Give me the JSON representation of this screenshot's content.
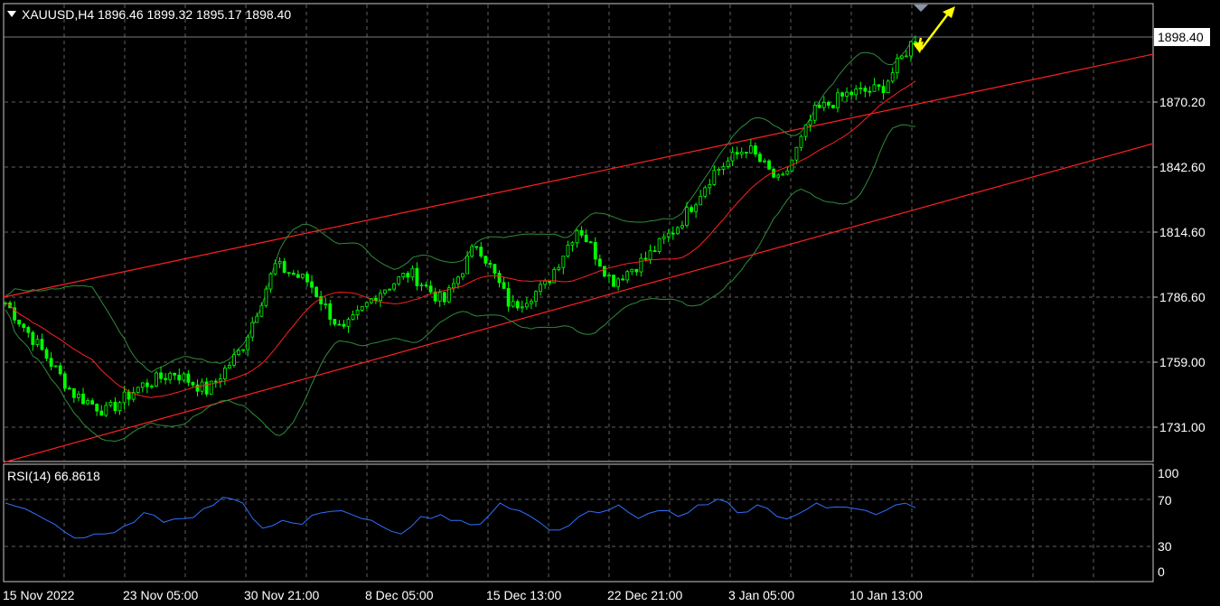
{
  "window": {
    "symbol_header": "XAUUSD,H4  1896.46 1899.32 1895.17 1898.40"
  },
  "colors": {
    "background": "#000000",
    "grid": "#5f5f5f",
    "frame": "#c8c8c8",
    "candle_up": "#00ff00",
    "candle_down": "#00ff00",
    "bollinger": "#2e8b3a",
    "ma": "#ff2020",
    "channel": "#ff2020",
    "rsi_line": "#2f6fff",
    "arrow": "#ffff00",
    "price_tag_bg": "#ffffff",
    "price_tag_text": "#000000"
  },
  "price_axis": {
    "ticks": [
      "1898.40",
      "1870.20",
      "1842.60",
      "1814.60",
      "1786.60",
      "1759.00",
      "1731.00"
    ],
    "current_price_label": "1898.40"
  },
  "time_axis": {
    "labels": [
      "15 Nov 2022",
      "23 Nov 05:00",
      "30 Nov 21:00",
      "8 Dec 05:00",
      "15 Dec 13:00",
      "22 Dec 21:00",
      "3 Jan 05:00",
      "10 Jan 13:00"
    ]
  },
  "rsi_panel": {
    "title": "RSI(14) 66.8618",
    "ticks": [
      "100",
      "70",
      "30",
      "0"
    ]
  },
  "chart_data": [
    {
      "type": "candlestick",
      "title": "XAUUSD,H4",
      "ohlc_last": {
        "open": 1896.46,
        "high": 1899.32,
        "low": 1895.17,
        "close": 1898.4
      },
      "ylim": [
        1720,
        1912
      ],
      "indicators": [
        "Bollinger Bands",
        "Moving Average",
        "Ascending channel"
      ],
      "close_path": [
        {
          "x": "15 Nov 2022",
          "y": 1784
        },
        {
          "x": "17 Nov",
          "y": 1765
        },
        {
          "x": "19 Nov",
          "y": 1745
        },
        {
          "x": "21 Nov",
          "y": 1737
        },
        {
          "x": "23 Nov 05:00",
          "y": 1748
        },
        {
          "x": "25 Nov",
          "y": 1754
        },
        {
          "x": "28 Nov",
          "y": 1746
        },
        {
          "x": "30 Nov 21:00",
          "y": 1764
        },
        {
          "x": "1 Dec",
          "y": 1800
        },
        {
          "x": "2 Dec",
          "y": 1793
        },
        {
          "x": "5 Dec",
          "y": 1771
        },
        {
          "x": "8 Dec 05:00",
          "y": 1788
        },
        {
          "x": "9 Dec",
          "y": 1797
        },
        {
          "x": "12 Dec",
          "y": 1784
        },
        {
          "x": "13 Dec",
          "y": 1810
        },
        {
          "x": "15 Dec 13:00",
          "y": 1782
        },
        {
          "x": "19 Dec",
          "y": 1791
        },
        {
          "x": "21 Dec",
          "y": 1817
        },
        {
          "x": "22 Dec 21:00",
          "y": 1793
        },
        {
          "x": "27 Dec",
          "y": 1803
        },
        {
          "x": "29 Dec",
          "y": 1818
        },
        {
          "x": "30 Dec",
          "y": 1840
        },
        {
          "x": "3 Jan 05:00",
          "y": 1851
        },
        {
          "x": "5 Jan",
          "y": 1835
        },
        {
          "x": "6 Jan",
          "y": 1866
        },
        {
          "x": "9 Jan",
          "y": 1874
        },
        {
          "x": "10 Jan 13:00",
          "y": 1876
        },
        {
          "x": "12 Jan",
          "y": 1898.4
        }
      ]
    },
    {
      "type": "line",
      "title": "RSI(14) 66.8618",
      "ylim": [
        0,
        100
      ],
      "levels": [
        30,
        70
      ],
      "series": [
        {
          "name": "RSI(14)",
          "values": [
            72,
            66,
            55,
            42,
            36,
            40,
            48,
            62,
            52,
            56,
            66,
            78,
            72,
            46,
            54,
            50,
            62,
            64,
            56,
            48,
            40,
            58,
            60,
            54,
            50,
            72,
            64,
            52,
            44,
            58,
            62,
            70,
            56,
            64,
            58,
            70,
            76,
            62,
            70,
            58,
            60,
            72,
            68,
            66,
            60,
            70,
            67
          ]
        }
      ]
    }
  ]
}
